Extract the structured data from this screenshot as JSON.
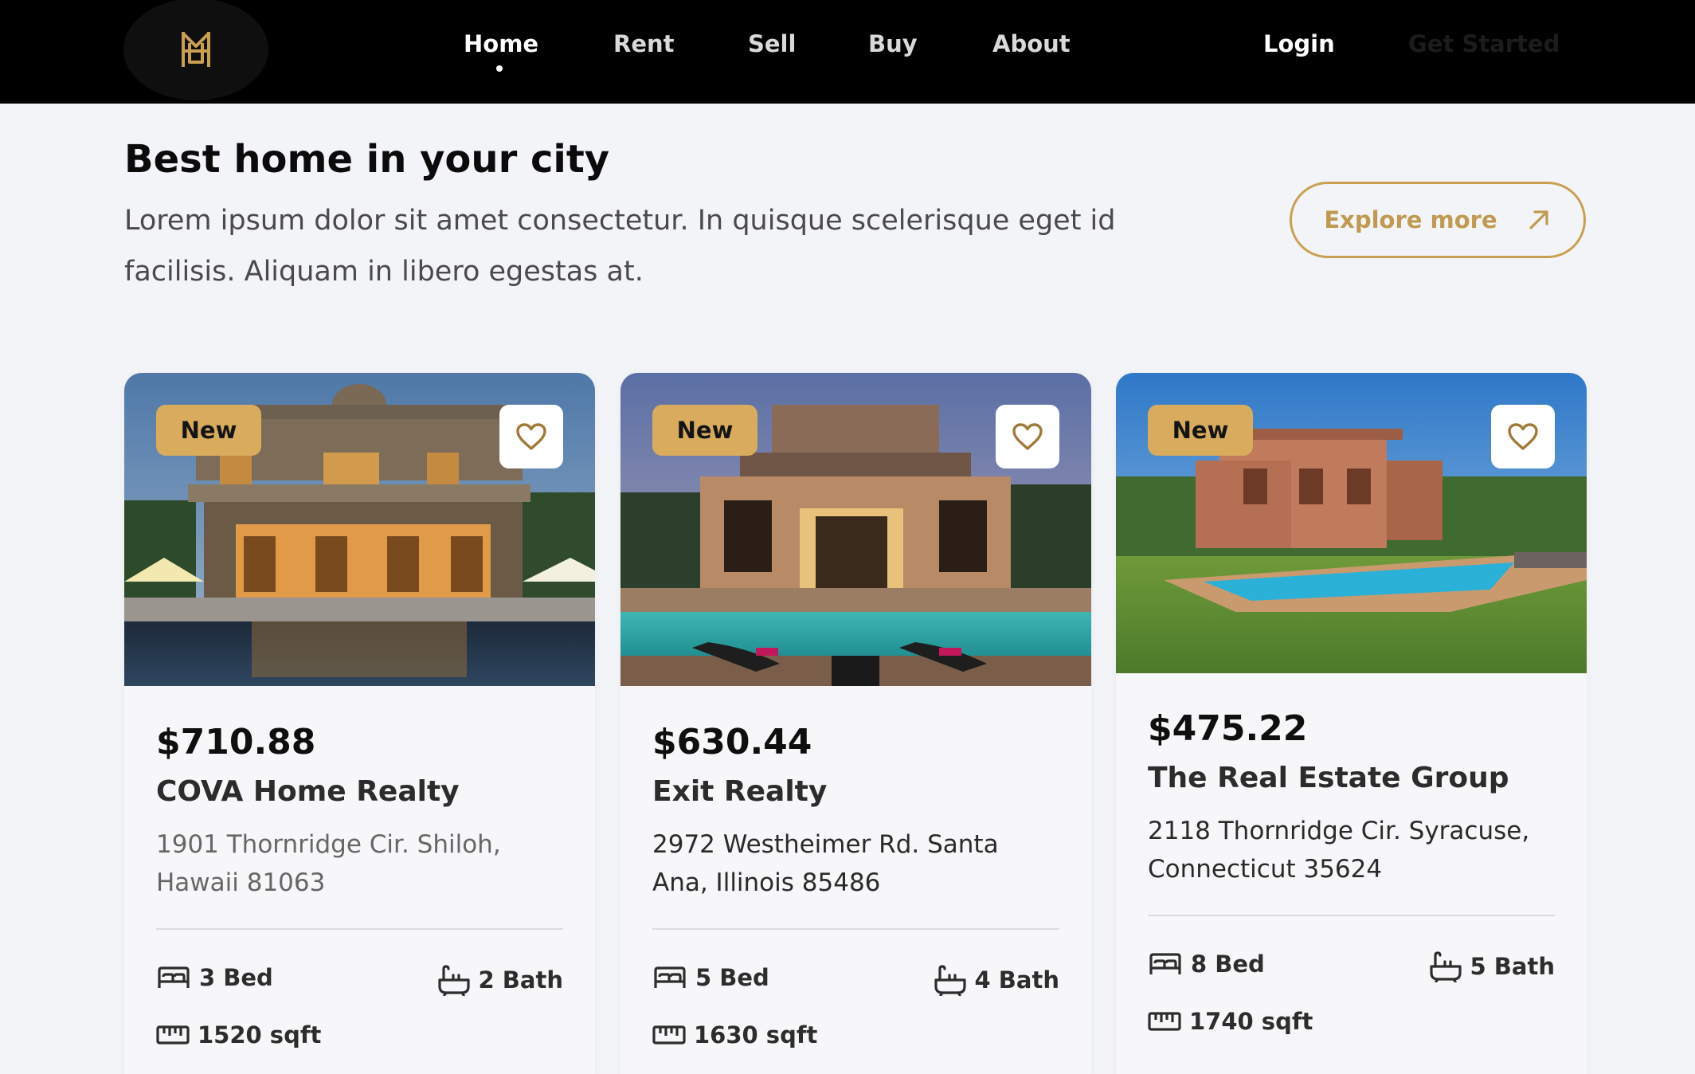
{
  "nav": {
    "logo_name": "monogram-logo",
    "links": [
      "Home",
      "Rent",
      "Sell",
      "Buy",
      "About"
    ],
    "login": "Login",
    "get_started": "Get Started"
  },
  "intro": {
    "title": "Best home in your city",
    "text": "Lorem ipsum dolor sit amet consectetur. In quisque scelerisque eget id facilisis. Aliquam in libero egestas at.",
    "explore_label": "Explore more"
  },
  "colors": {
    "accent": "#c9a052",
    "badge": "#d8ab5d",
    "nav_bg": "#000000",
    "page_bg": "#f3f4f8"
  },
  "listings": [
    {
      "badge": "New",
      "price": "$710.88",
      "agency": "COVA Home Realty",
      "address": "1901 Thornridge Cir. Shiloh, Hawaii 81063",
      "bed": "3 Bed",
      "bath": "2 Bath",
      "area": "1520 sqft"
    },
    {
      "badge": "New",
      "price": "$630.44",
      "agency": "Exit Realty",
      "address": "2972 Westheimer Rd. Santa Ana, Illinois 85486",
      "bed": "5 Bed",
      "bath": "4 Bath",
      "area": "1630 sqft"
    },
    {
      "badge": "New",
      "price": "$475.22",
      "agency": "The Real Estate Group",
      "address": "2118 Thornridge Cir. Syracuse, Connecticut 35624",
      "bed": "8 Bed",
      "bath": "5 Bath",
      "area": "1740 sqft"
    }
  ],
  "icons": {
    "favorite": "heart-icon",
    "bed": "bed-icon",
    "bath": "bathtub-icon",
    "area": "ruler-icon",
    "explore": "arrow-up-right-icon"
  }
}
